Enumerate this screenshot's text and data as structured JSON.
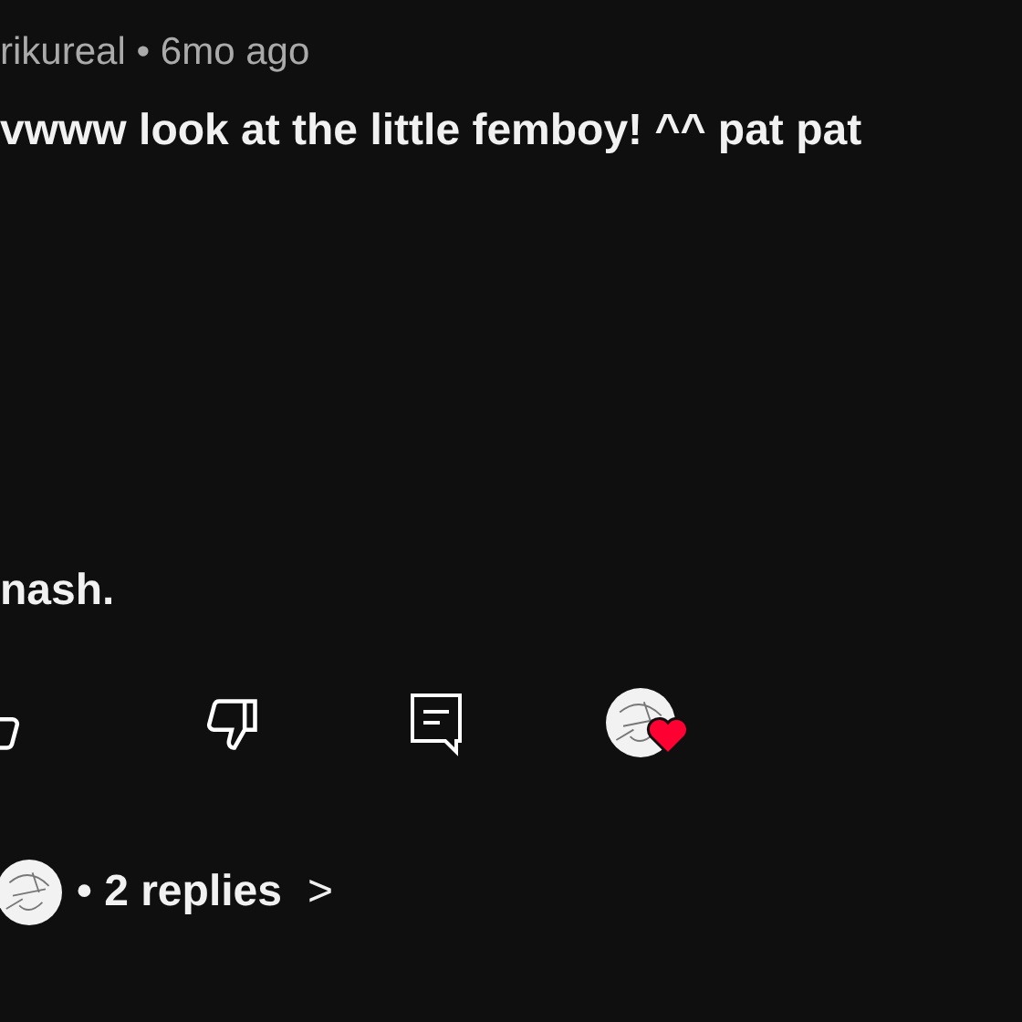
{
  "comment": {
    "author": "rikureal",
    "separator": "•",
    "time": "6mo ago",
    "text_line_1": "vwww look at the little femboy! ^^ pat pat",
    "text_line_2": "nash."
  },
  "actions": {
    "creator_heart": true
  },
  "replies": {
    "separator": "•",
    "label": "2 replies",
    "chevron": ">"
  }
}
